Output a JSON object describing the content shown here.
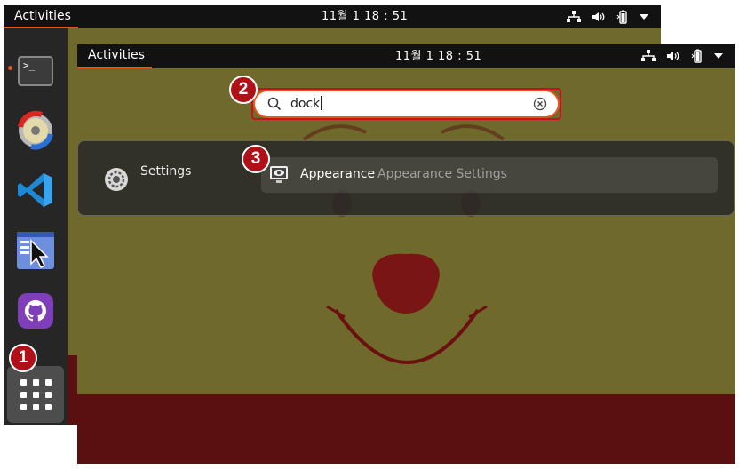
{
  "back": {
    "topbar": {
      "activities": "Activities",
      "clock": "11월 1  18 : 51"
    },
    "dock": {
      "apps": [
        {
          "name": "terminal",
          "glyph": ">_"
        },
        {
          "name": "disc-burner"
        },
        {
          "name": "vscode"
        },
        {
          "name": "screenshot-tool"
        },
        {
          "name": "github"
        }
      ]
    }
  },
  "front": {
    "topbar": {
      "activities": "Activities",
      "clock": "11월 1  18 : 51"
    },
    "search": {
      "value": "dock"
    },
    "results": {
      "provider": "Settings",
      "items": [
        {
          "title": "Appearance",
          "description": "Appearance Settings"
        }
      ]
    }
  },
  "steps": {
    "one": "1",
    "two": "2",
    "three": "3"
  },
  "colors": {
    "accent": "#e95420",
    "marker": "#b01018",
    "desktop": "#6f6a2c",
    "face": "#5a1010"
  }
}
